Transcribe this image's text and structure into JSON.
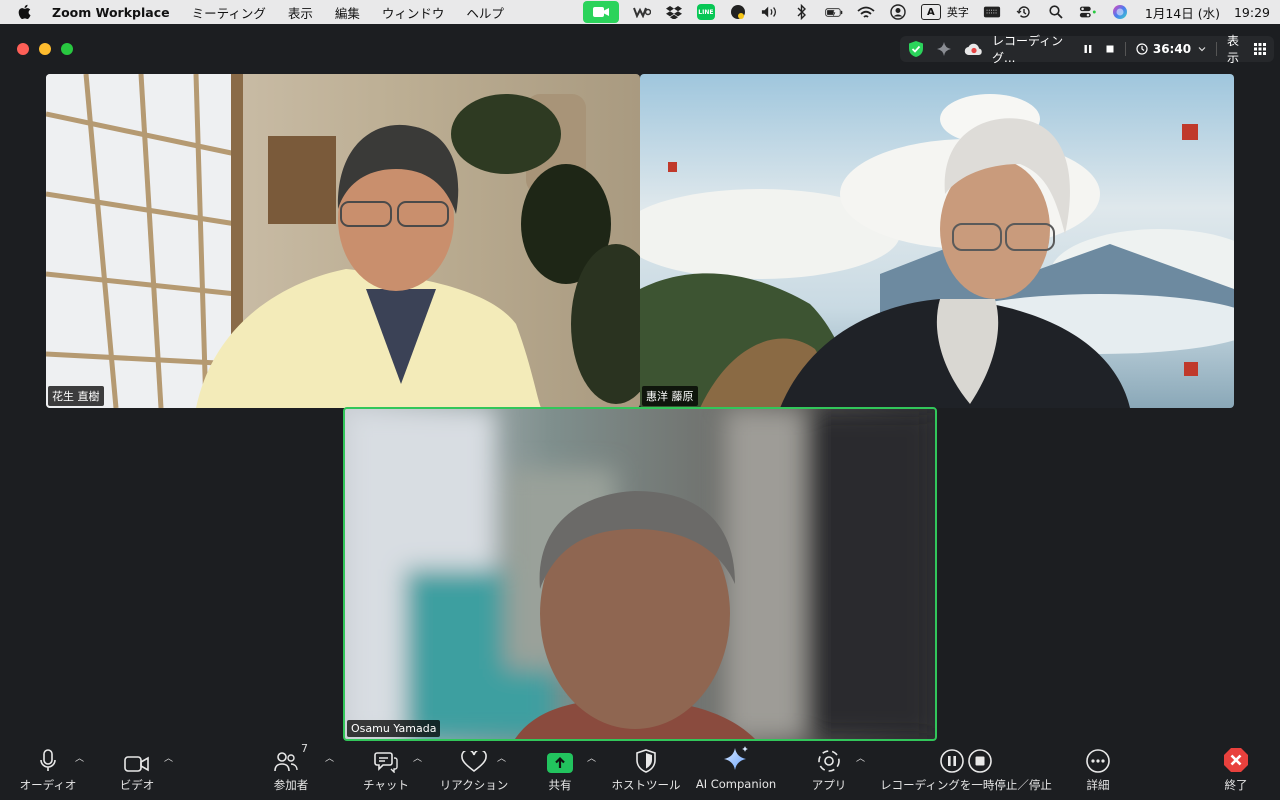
{
  "menubar": {
    "app_name": "Zoom Workplace",
    "menus": [
      "ミーティング",
      "表示",
      "編集",
      "ウィンドウ",
      "ヘルプ"
    ],
    "line_label": "LINE",
    "input_mode_box": "A",
    "input_mode_label": "英字",
    "date": "1月14日 (水)",
    "time": "19:29",
    "icons": [
      "apple-logo",
      "zoom-camera",
      "weibo-like",
      "dropbox",
      "line",
      "night-owl",
      "volume",
      "bluetooth",
      "battery",
      "wifi",
      "user-account",
      "input-method",
      "keyboard",
      "time-machine",
      "search",
      "control-center",
      "siri"
    ]
  },
  "recording_bar": {
    "recording_label": "レコーディング...",
    "timer": "36:40",
    "view_label": "表示",
    "colors": {
      "shield": "#2bd35b",
      "record_dot": "#e64545"
    }
  },
  "participants": [
    {
      "name": "花生 直樹"
    },
    {
      "name": "惠洋 藤原"
    },
    {
      "name": "Osamu Yamada",
      "active_speaker": true
    }
  ],
  "toolbar": {
    "audio": "オーディオ",
    "video": "ビデオ",
    "participants": "参加者",
    "participant_count": "7",
    "chat": "チャット",
    "reactions": "リアクション",
    "share": "共有",
    "host_tools": "ホストツール",
    "ai_companion": "AI Companion",
    "apps": "アプリ",
    "recording": "レコーディングを一時停止／停止",
    "more": "詳細",
    "end": "終了",
    "colors": {
      "share_green": "#22c35e",
      "end_red": "#e8413d"
    }
  }
}
